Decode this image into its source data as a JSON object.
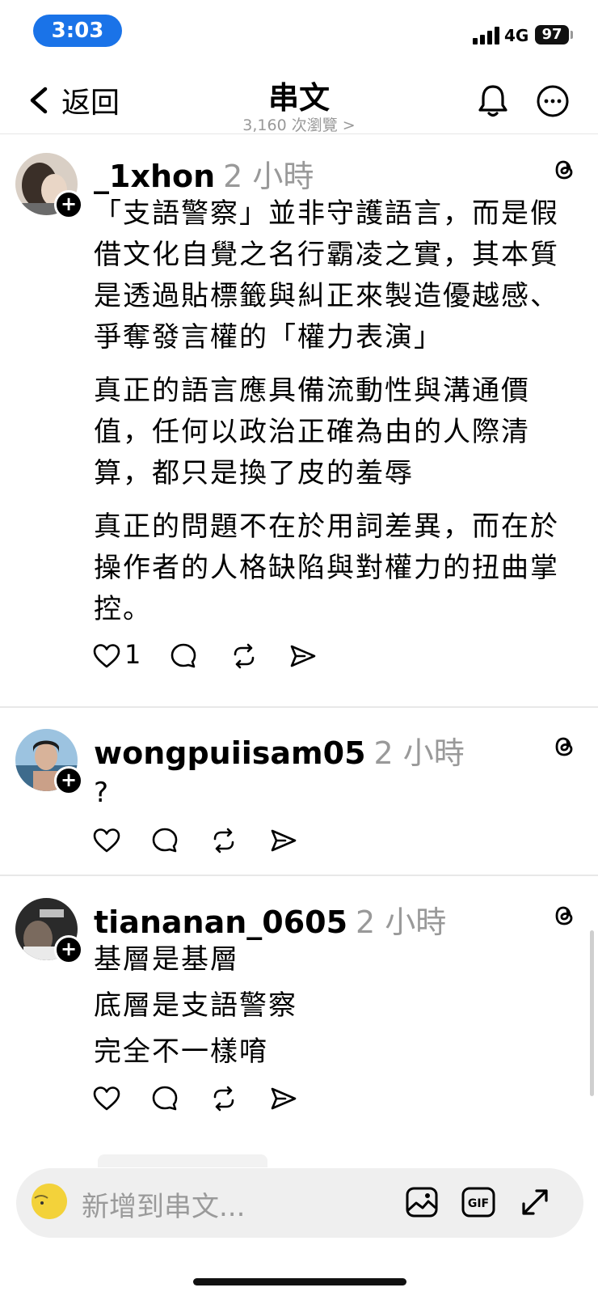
{
  "status_bar": {
    "time": "3:03",
    "network": "4G",
    "battery": "97"
  },
  "nav": {
    "back_label": "返回",
    "title": "串文",
    "views": "3,160 次瀏覽 >"
  },
  "posts": [
    {
      "username": "_1xhon",
      "time": "2 小時",
      "paragraphs": [
        "「支語警察」並非守護語言，而是假借文化自覺之名行霸凌之實，其本質是透過貼標籤與糾正來製造優越感、爭奪發言權的「權力表演」",
        "真正的語言應具備流動性與溝通價值，任何以政治正確為由的人際清算，都只是換了皮的羞辱",
        "真正的問題不在於用詞差異，而在於操作者的人格缺陷與對權力的扭曲掌控。"
      ],
      "likes": "1"
    },
    {
      "username": "wongpuiisam05",
      "time": "2 小時",
      "lines": [
        "?"
      ]
    },
    {
      "username": "tiananan_0605",
      "time": "2 小時",
      "lines": [
        "基層是基層",
        "底層是支語警察",
        "完全不一樣唷"
      ]
    }
  ],
  "composer": {
    "placeholder": "新增到串文..."
  },
  "colors": {
    "accent": "#1a73e8",
    "muted": "#999999"
  }
}
